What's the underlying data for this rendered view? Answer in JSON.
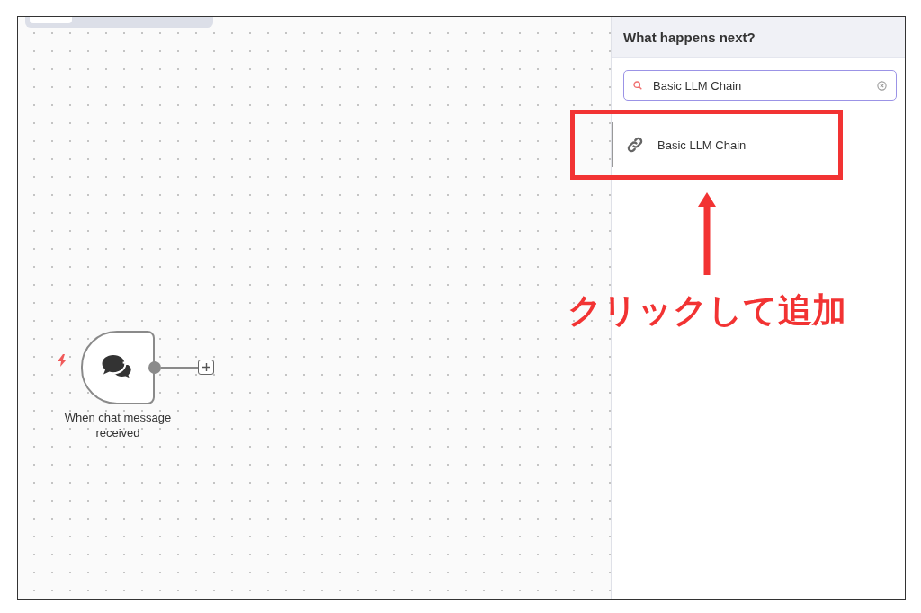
{
  "canvas": {
    "nodes": [
      {
        "label": "When chat message received",
        "kind": "trigger"
      }
    ]
  },
  "panel": {
    "title": "What happens next?",
    "search": {
      "value": "Basic LLM Chain"
    },
    "results": [
      {
        "label": "Basic LLM Chain",
        "selected": true
      }
    ]
  },
  "annotation": {
    "text": "クリックして追加"
  }
}
